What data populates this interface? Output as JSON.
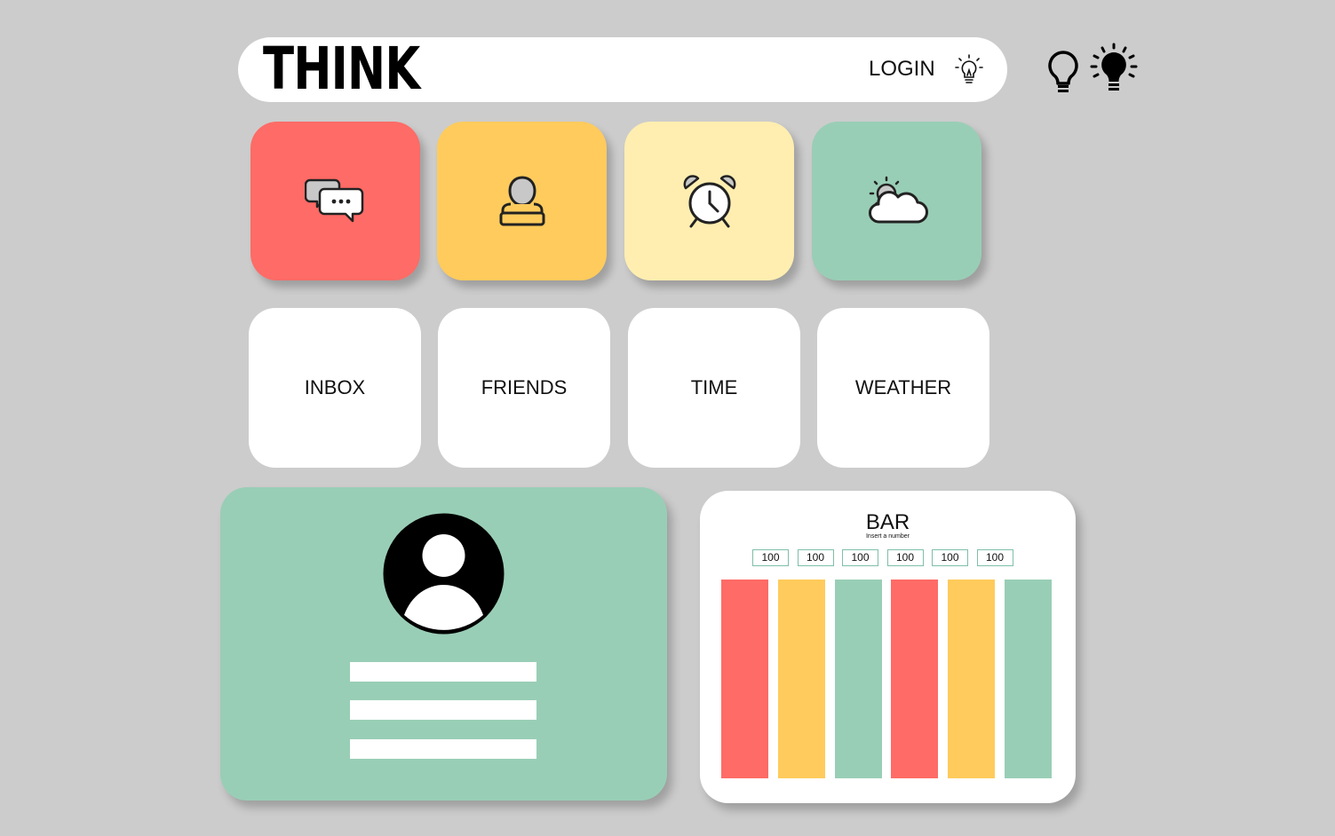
{
  "header": {
    "logo": "THINK",
    "login_label": "LOGIN"
  },
  "icons": {
    "login": "lightbulb-outline-icon",
    "theme_off": "lightbulb-off-icon",
    "theme_on": "lightbulb-on-icon"
  },
  "tiles": [
    {
      "icon": "chat-bubbles-icon",
      "color": "#ff6b66",
      "label": "INBOX"
    },
    {
      "icon": "user-icon",
      "color": "#ffcb5c",
      "label": "FRIENDS"
    },
    {
      "icon": "alarm-clock-icon",
      "color": "#ffeeb0",
      "label": "TIME"
    },
    {
      "icon": "partly-cloudy-icon",
      "color": "#99ceb6",
      "label": "WEATHER"
    }
  ],
  "profile": {
    "avatar": "avatar-icon",
    "color": "#99ceb6"
  },
  "bar_widget": {
    "title": "BAR",
    "subtitle": "Insert a number",
    "inputs": [
      "100",
      "100",
      "100",
      "100",
      "100",
      "100"
    ]
  },
  "chart_data": {
    "type": "bar",
    "title": "BAR",
    "categories": [
      "",
      "",
      "",
      "",
      "",
      ""
    ],
    "values": [
      100,
      100,
      100,
      100,
      100,
      100
    ],
    "colors": [
      "#ff6b66",
      "#ffcb5c",
      "#99ceb6",
      "#ff6b66",
      "#ffcb5c",
      "#99ceb6"
    ],
    "ylim": [
      0,
      100
    ],
    "grid": false
  }
}
